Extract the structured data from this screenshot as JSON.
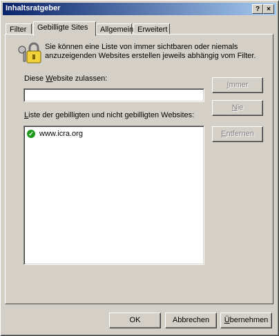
{
  "window": {
    "title": "Inhaltsratgeber",
    "help_button": "?",
    "close_button": "×"
  },
  "tabs": [
    {
      "label": "Filter",
      "active": false
    },
    {
      "label": "Gebilligte Sites",
      "active": true
    },
    {
      "label": "Allgemein",
      "active": false
    },
    {
      "label": "Erweitert",
      "active": false
    }
  ],
  "approved_sites": {
    "description": "Sie können eine Liste von immer sichtbaren oder niemals anzuzeigenden Websites erstellen jeweils abhängig vom Filter.",
    "allow_label_pre": "Diese ",
    "allow_label_mnemonic": "W",
    "allow_label_post": "ebsite zulassen:",
    "website_input_value": "",
    "list_label_mnemonic": "L",
    "list_label_post": "iste der gebilligten und nicht gebilligten Websites:",
    "list_items": [
      {
        "site": "www.icra.org",
        "status_icon": "approved-check-icon"
      }
    ],
    "always_button": {
      "mnemonic": "I",
      "rest": "mmer",
      "enabled": false
    },
    "never_button": {
      "mnemonic": "N",
      "rest": "ie",
      "enabled": false
    },
    "remove_button": {
      "mnemonic": "E",
      "rest": "ntfernen",
      "enabled": false
    }
  },
  "footer": {
    "ok_label": "OK",
    "cancel_label": "Abbrechen",
    "apply_mnemonic": "Ü",
    "apply_rest": "bernehmen"
  },
  "colors": {
    "face": "#d4d0c8",
    "title_start": "#0a246a",
    "title_end": "#a6caf0",
    "approved": "#1f9a1f"
  }
}
